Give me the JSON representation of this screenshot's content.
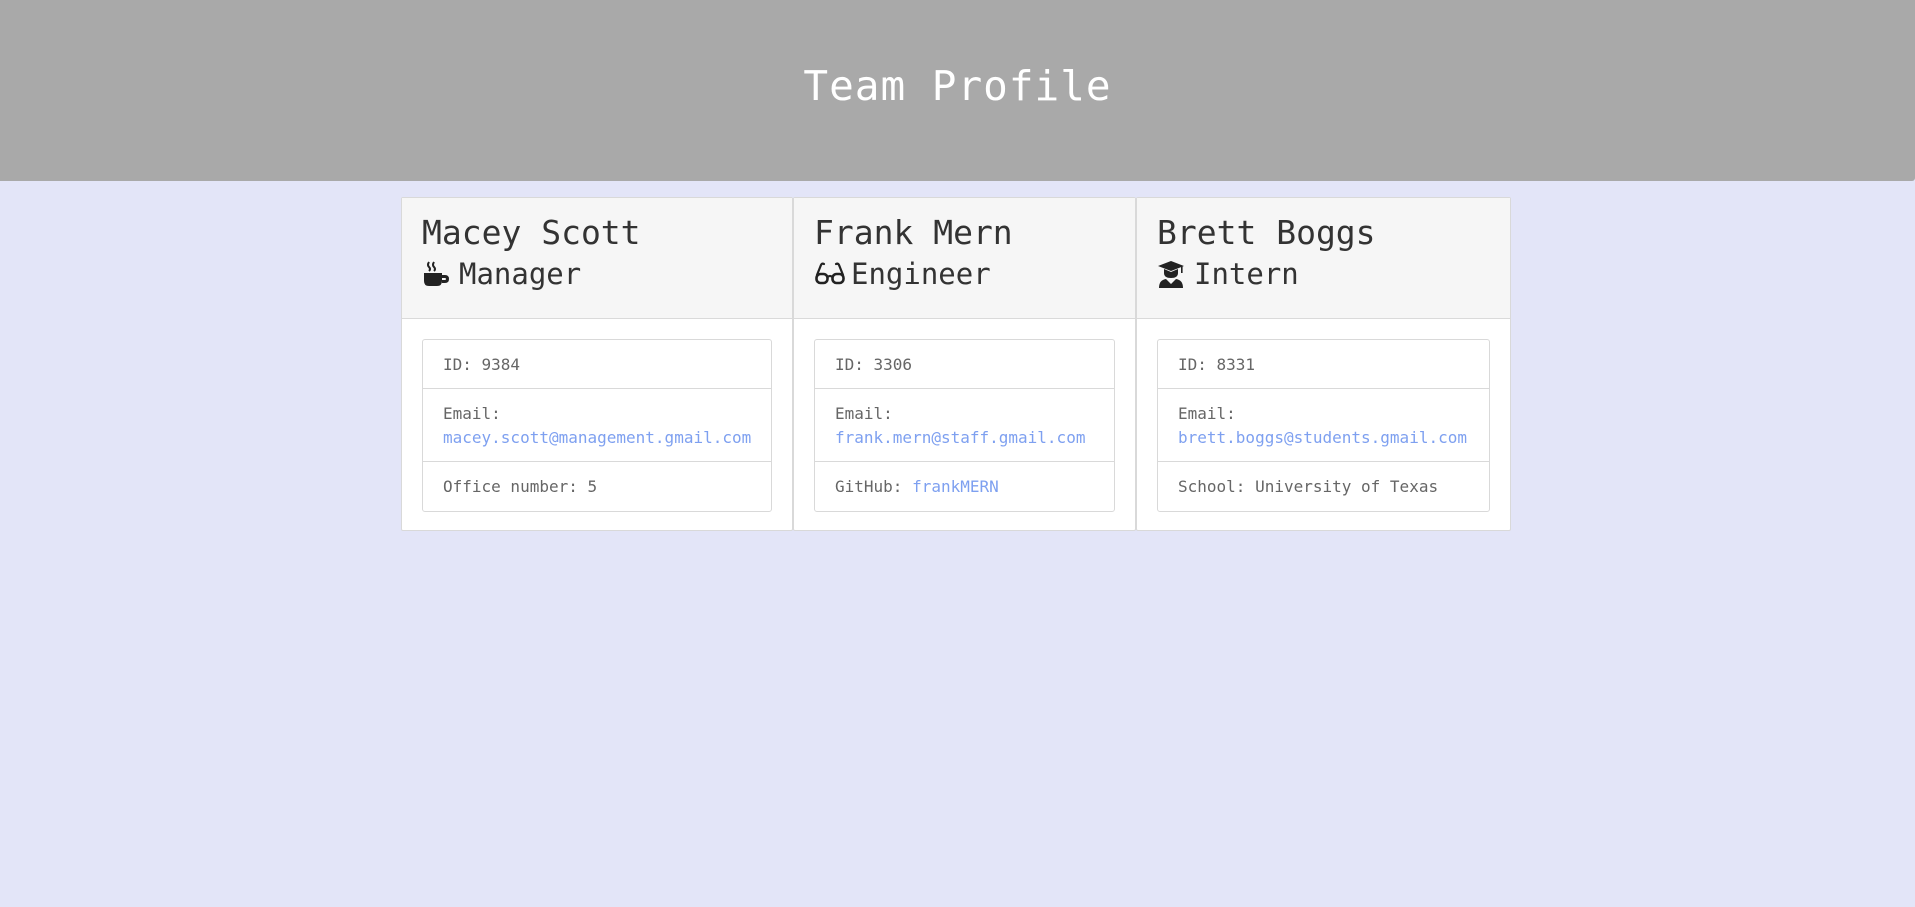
{
  "header": {
    "title": "Team Profile"
  },
  "colors": {
    "background": "#e3e5f8",
    "header": "#a9a9a9",
    "link": "#7ea0f0"
  },
  "employees": [
    {
      "name": "Macey Scott",
      "role": "Manager",
      "icon": "coffee-mug-icon",
      "id_label": "ID: 9384",
      "email_label": "Email:",
      "email": "macey.scott@management.gmail.com",
      "extra_label": "Office number: 5",
      "extra_link": ""
    },
    {
      "name": "Frank Mern",
      "role": "Engineer",
      "icon": "glasses-icon",
      "id_label": "ID: 3306",
      "email_label": "Email:",
      "email": "frank.mern@staff.gmail.com",
      "extra_label": "GitHub:",
      "extra_link": "frankMERN"
    },
    {
      "name": "Brett Boggs",
      "role": "Intern",
      "icon": "graduate-icon",
      "id_label": "ID: 8331",
      "email_label": "Email:",
      "email": "brett.boggs@students.gmail.com",
      "extra_label": "School: University of Texas",
      "extra_link": ""
    }
  ]
}
